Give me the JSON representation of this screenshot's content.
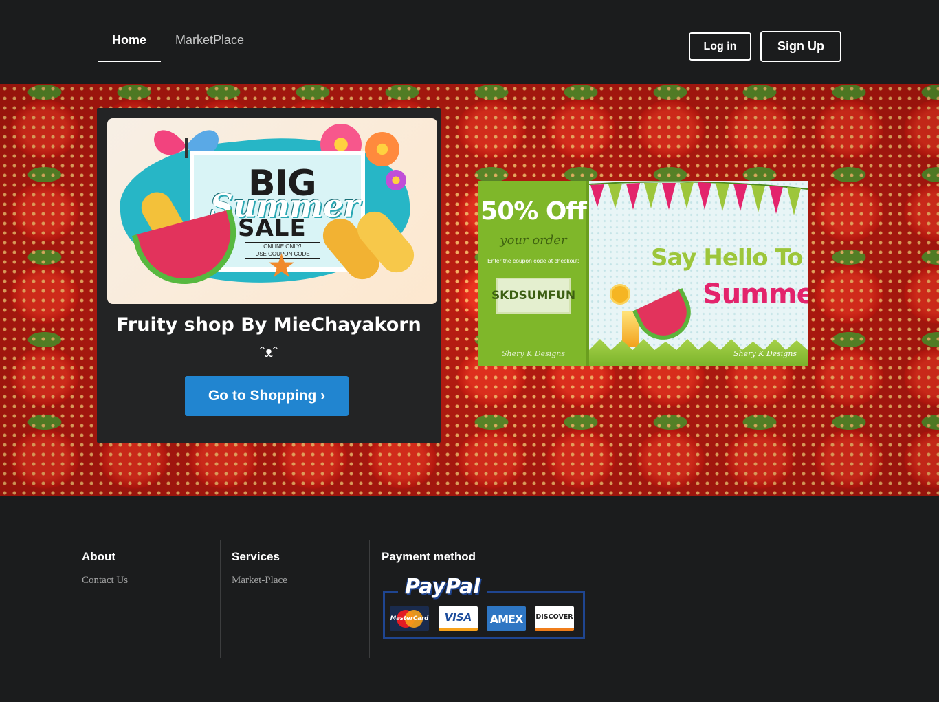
{
  "nav": {
    "home": "Home",
    "marketplace": "MarketPlace",
    "login": "Log in",
    "signup": "Sign Up"
  },
  "hero": {
    "promo_image": {
      "big": "BIG",
      "summer": "Summer",
      "sale": "SALE",
      "online_only": "ONLINE ONLY!",
      "coupon_code": "USE COUPON CODE"
    },
    "title": "Fruity shop By MieChayakorn",
    "emoji": "ˆᴥˆ",
    "shop_button": "Go to Shopping ›",
    "coupon_banner": {
      "discount": "50% Off",
      "your_order": "your order",
      "enter_code": "Enter the coupon code at checkout:",
      "code": "SKDSUMFUN",
      "signature": "Shery K Designs",
      "hello": "Say Hello To",
      "summer": "Summer",
      "signature_right": "Shery K Designs"
    }
  },
  "footer": {
    "about": {
      "heading": "About",
      "link": "Contact Us"
    },
    "services": {
      "heading": "Services",
      "link": "Market-Place"
    },
    "payment": {
      "heading": "Payment method",
      "paypal": "PayPal",
      "cards": [
        "MasterCard",
        "VISA",
        "AMEX",
        "DISCOVER"
      ]
    }
  },
  "colors": {
    "background": "#1b1c1d",
    "card": "#232425",
    "primary_button": "#2185d0",
    "hero": "#c4180f"
  }
}
